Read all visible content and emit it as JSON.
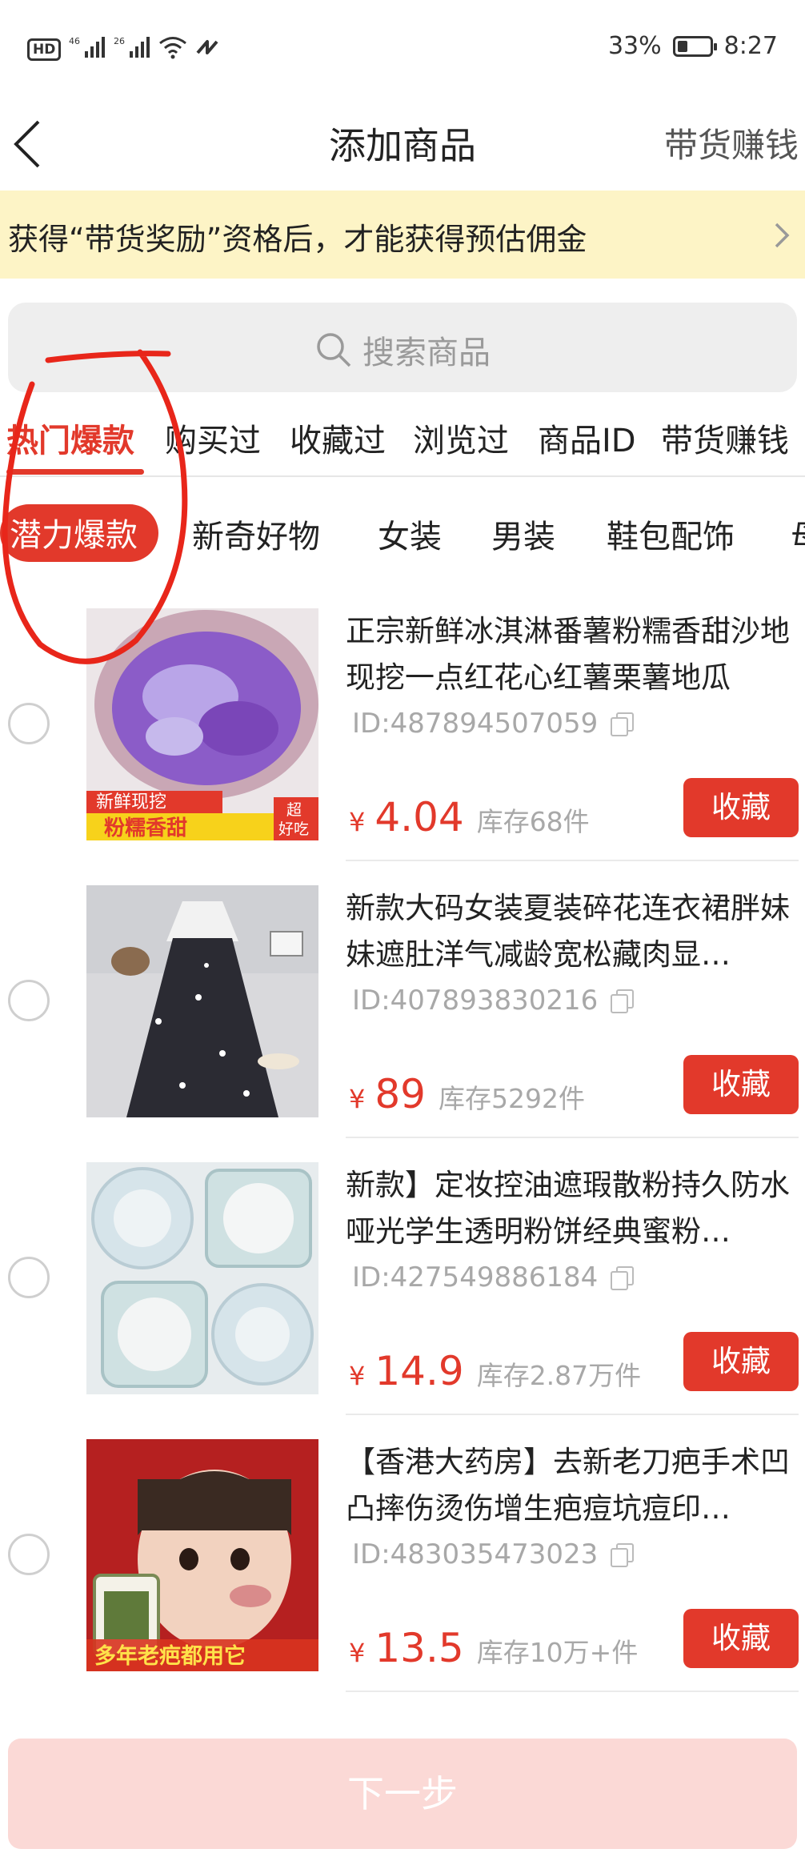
{
  "status_bar": {
    "left_badges": [
      "HD",
      "46",
      "26"
    ],
    "battery": "33%",
    "battery_level": 0.33,
    "time": "8:27"
  },
  "nav": {
    "title": "添加商品",
    "right_link": "带货赚钱"
  },
  "notice": {
    "text": "获得“带货奖励”资格后，才能获得预估佣金"
  },
  "search": {
    "placeholder": "搜索商品"
  },
  "tabs": [
    {
      "label": "热门爆款",
      "active": true
    },
    {
      "label": "购买过"
    },
    {
      "label": "收藏过"
    },
    {
      "label": "浏览过"
    },
    {
      "label": "商品ID"
    },
    {
      "label": "带货赚钱"
    }
  ],
  "categories": [
    {
      "label": "潜力爆款",
      "active": true
    },
    {
      "label": "新奇好物"
    },
    {
      "label": "女装"
    },
    {
      "label": "男装"
    },
    {
      "label": "鞋包配饰"
    },
    {
      "label": "母"
    }
  ],
  "products": [
    {
      "title": "正宗新鲜冰淇淋番薯粉糯香甜沙地现挖一点红花心红薯栗薯地瓜",
      "id": "ID:487894507059",
      "currency": "¥",
      "price": "4.04",
      "stock": "库存68件",
      "fav_label": "收藏",
      "thumb_caption_top": "新鲜现挖",
      "thumb_caption_main": "粉糯香甜",
      "thumb_caption_badge_1": "超",
      "thumb_caption_badge_2": "好吃"
    },
    {
      "title": "新款大码女装夏装碎花连衣裙胖妹妹遮肚洋气减龄宽松藏肉显…",
      "id": "ID:407893830216",
      "currency": "¥",
      "price": "89",
      "stock": "库存5292件",
      "fav_label": "收藏"
    },
    {
      "title": "新款】定妆控油遮瑕散粉持久防水哑光学生透明粉饼经典蜜粉…",
      "id": "ID:427549886184",
      "currency": "¥",
      "price": "14.9",
      "stock": "库存2.87万件",
      "fav_label": "收藏"
    },
    {
      "title": "【香港大药房】去新老刀疤手术凹凸摔伤烫伤增生疤痘坑痘印…",
      "id": "ID:483035473023",
      "currency": "¥",
      "price": "13.5",
      "stock": "库存10万+件",
      "fav_label": "收藏",
      "thumb_caption_main": "多年老疤都用它"
    }
  ],
  "next_button": {
    "label": "下一步"
  },
  "colors": {
    "accent": "#e2392b",
    "notice_bg": "#fdf4c6",
    "next_disabled_bg": "#fbd9d6"
  }
}
